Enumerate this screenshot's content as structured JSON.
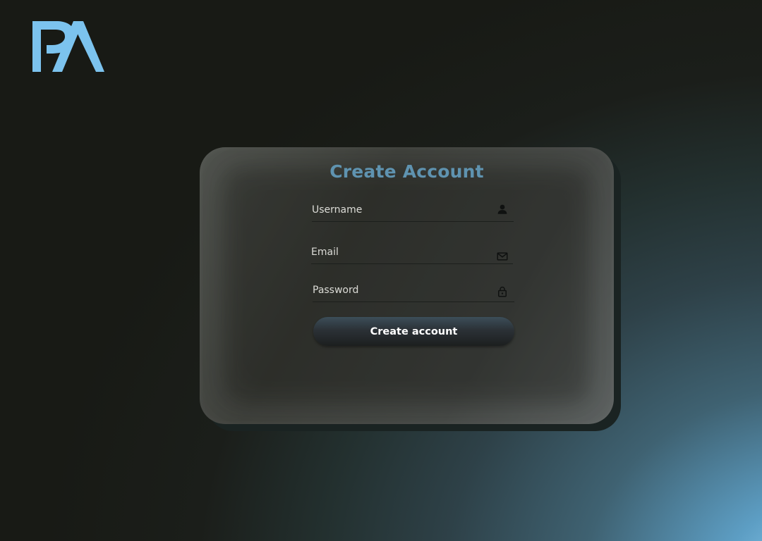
{
  "brand": {
    "logo_text": "PA",
    "logo_color": "#7cc3ee"
  },
  "form": {
    "title": "Create Account",
    "title_color": "#5f93b0",
    "fields": [
      {
        "placeholder": "Username",
        "value": "",
        "icon": "user-icon"
      },
      {
        "placeholder": "Email",
        "value": "",
        "icon": "mail-icon"
      },
      {
        "placeholder": "Password",
        "value": "",
        "icon": "lock-icon"
      }
    ],
    "submit_label": "Create account"
  }
}
